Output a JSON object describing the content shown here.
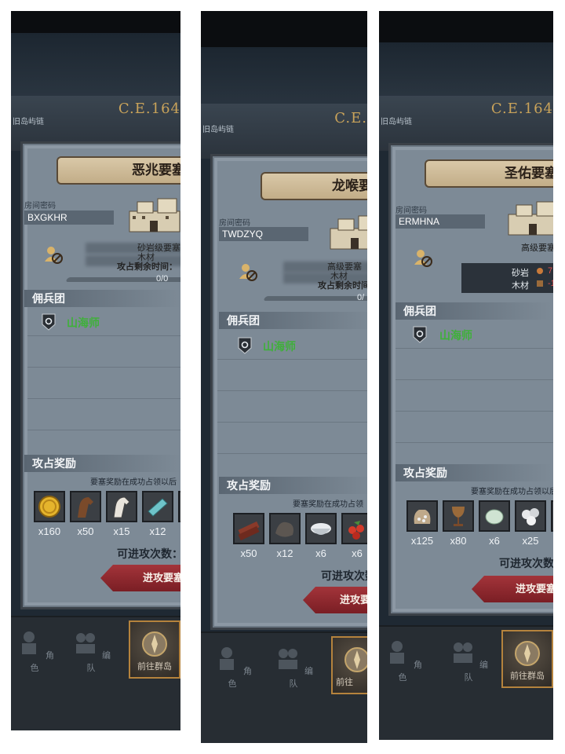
{
  "screens": [
    {
      "title": "恶兆要塞",
      "room_code_label": "房间密码",
      "room_code": "BXGKHR",
      "fortress_level": "砂岩级要塞",
      "material": "木材",
      "attack_time_label": "攻占剩余时间：",
      "progress_text": "0/0",
      "mercenary_section": "佣兵团",
      "mercenary_name": "山海师",
      "rewards_section": "攻占奖励",
      "reward_note": "要塞奖励在成功占领以后",
      "items": [
        {
          "name": "gold-coin-icon",
          "count": "x160"
        },
        {
          "name": "brown-horse-icon",
          "count": "x50"
        },
        {
          "name": "white-horse-icon",
          "count": "x15"
        },
        {
          "name": "cloth-icon",
          "count": "x12"
        }
      ],
      "attempts_label": "可进攻次数：",
      "attack_button": "进攻要塞",
      "era": "C.E.164",
      "old_map": "旧岛屿链",
      "nav": [
        "角色",
        "编队",
        "前往群岛"
      ]
    },
    {
      "title": "龙喉要",
      "room_code_label": "房间密码",
      "room_code": "TWDZYQ",
      "fortress_level": "高级要塞",
      "material": "木材",
      "attack_time_label": "攻占剩余时间",
      "progress_text": "0/",
      "mercenary_section": "佣兵团",
      "mercenary_name": "山海师",
      "rewards_section": "攻占奖励",
      "reward_note": "要塞奖励在成功占领",
      "items": [
        {
          "name": "wood-log-icon",
          "count": "x50"
        },
        {
          "name": "ore-icon",
          "count": "x12"
        },
        {
          "name": "salt-bowl-icon",
          "count": "x6"
        },
        {
          "name": "berries-icon",
          "count": "x6"
        }
      ],
      "attempts_label": "可进攻次数",
      "attack_button": "进攻要",
      "era": "C.E.",
      "old_map": "旧岛屿链",
      "nav": [
        "角色",
        "编队",
        "前往"
      ]
    },
    {
      "title": "圣佑要塞",
      "room_code_label": "房间密码",
      "room_code": "ERMHNA",
      "fortress_level": "高级要塞",
      "materials_list": [
        {
          "label": "砂岩",
          "value": "7"
        },
        {
          "label": "木材",
          "value": "-1"
        }
      ],
      "attack_time_label": "攻占剩余时间",
      "mercenary_section": "佣兵团",
      "mercenary_name": "山海师",
      "rewards_section": "攻占奖励",
      "reward_note": "要塞奖励在成功占领以后",
      "items": [
        {
          "name": "seed-sack-icon",
          "count": "x125"
        },
        {
          "name": "goblet-icon",
          "count": "x80"
        },
        {
          "name": "gem-stone-icon",
          "count": "x6"
        },
        {
          "name": "pearls-icon",
          "count": "x25"
        }
      ],
      "attempts_label": "可进攻次数：",
      "attack_button": "进攻要塞",
      "era": "C.E.164",
      "old_map": "旧岛屿链",
      "nav": [
        "角色",
        "编队",
        "前往群岛"
      ]
    }
  ]
}
